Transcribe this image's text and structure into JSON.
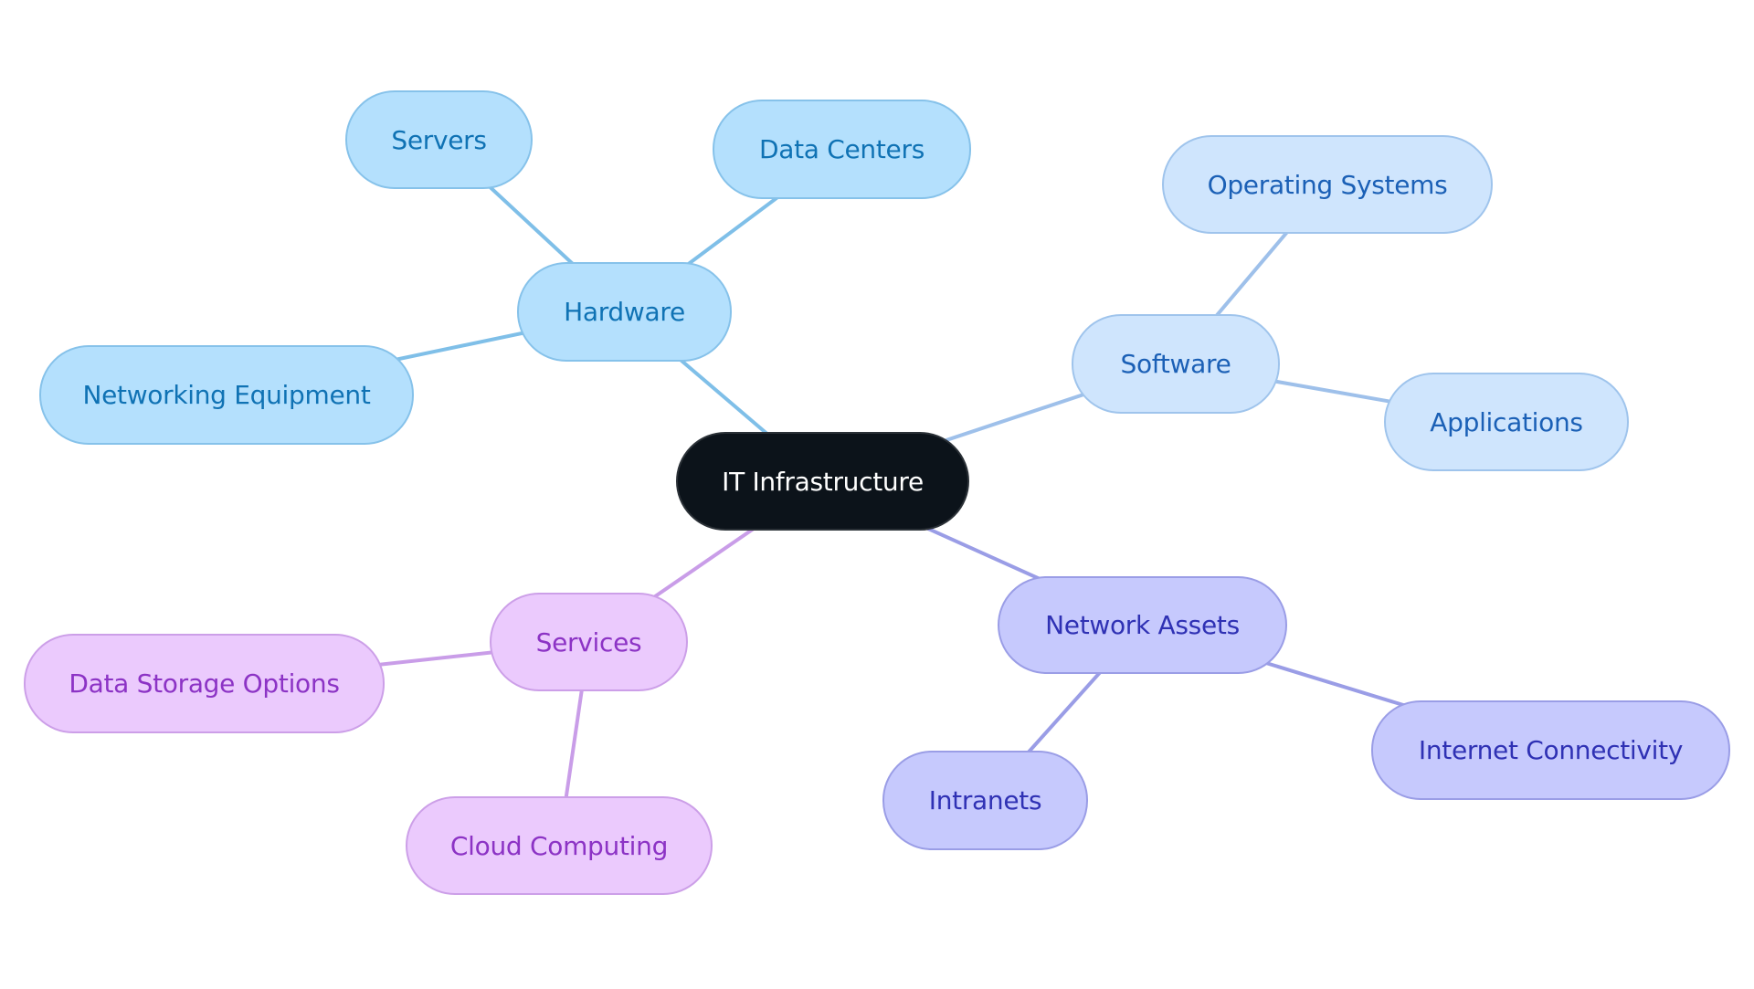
{
  "diagram": {
    "type": "mind-map",
    "root": {
      "id": "root",
      "label": "IT Infrastructure"
    },
    "branches": [
      {
        "id": "hardware",
        "label": "Hardware",
        "group": "hw",
        "children": [
          {
            "id": "servers",
            "label": "Servers"
          },
          {
            "id": "datacenters",
            "label": "Data Centers"
          },
          {
            "id": "networking",
            "label": "Networking Equipment"
          }
        ]
      },
      {
        "id": "software",
        "label": "Software",
        "group": "sw",
        "children": [
          {
            "id": "os",
            "label": "Operating Systems"
          },
          {
            "id": "apps",
            "label": "Applications"
          }
        ]
      },
      {
        "id": "netassets",
        "label": "Network Assets",
        "group": "na",
        "children": [
          {
            "id": "intranets",
            "label": "Intranets"
          },
          {
            "id": "internet",
            "label": "Internet Connectivity"
          }
        ]
      },
      {
        "id": "services",
        "label": "Services",
        "group": "sv",
        "children": [
          {
            "id": "datastorage",
            "label": "Data Storage Options"
          },
          {
            "id": "cloud",
            "label": "Cloud Computing"
          }
        ]
      }
    ]
  },
  "colors": {
    "root_fill": "#0c131a",
    "hw_edge": "#7fbfe8",
    "sw_edge": "#9ec0ea",
    "na_edge": "#9a9de6",
    "sv_edge": "#c99de8"
  }
}
